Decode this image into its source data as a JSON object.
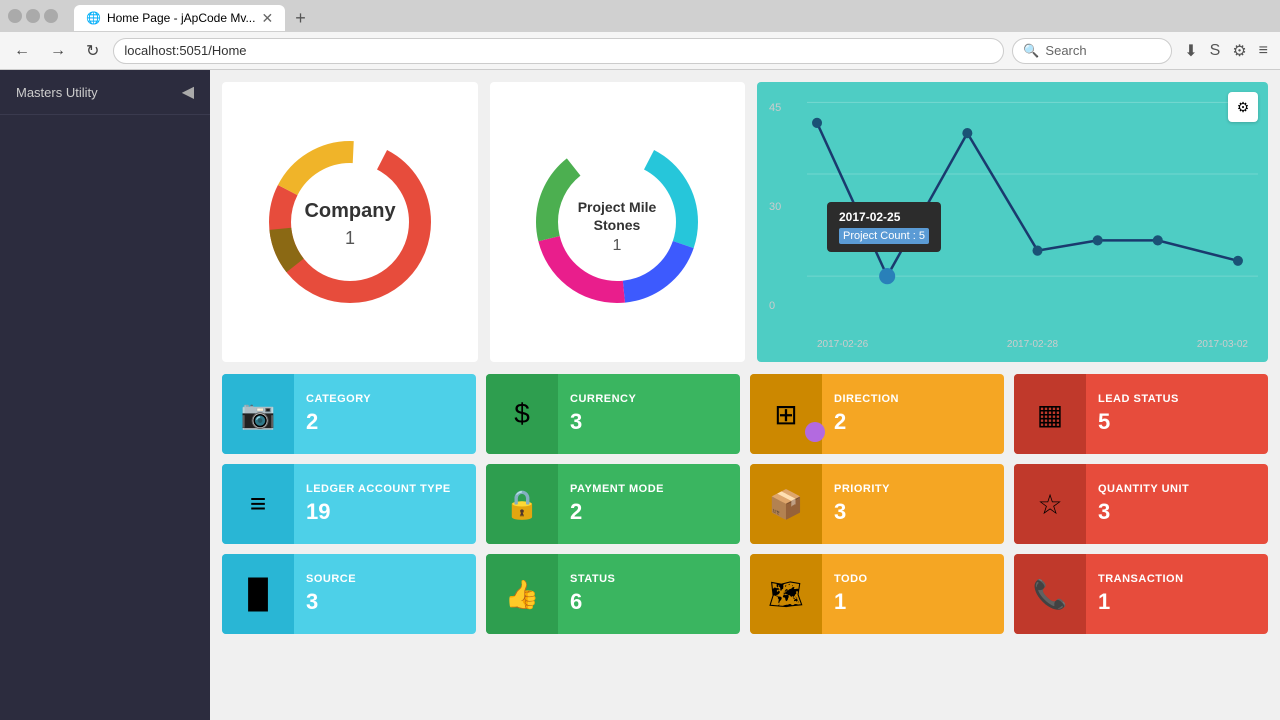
{
  "browser": {
    "title": "Home Page - jApCode Mv...",
    "url": "localhost:5051/Home",
    "search_placeholder": "Search",
    "new_tab_symbol": "+"
  },
  "sidebar": {
    "title": "Masters Utility",
    "toggle": "◀"
  },
  "charts": {
    "company": {
      "label": "Company",
      "value": "1"
    },
    "milestones": {
      "label": "Project Mile Stones",
      "value": "1"
    },
    "line": {
      "tooltip_date": "2017-02-25",
      "tooltip_label": "Project Count : 5",
      "y_labels": [
        "45",
        "30",
        "0"
      ],
      "x_labels": [
        "2017-02-26",
        "2017-02-28",
        "2017-03-02"
      ],
      "settings_icon": "⚙"
    }
  },
  "stats": [
    {
      "id": "category",
      "label": "CATEGORY",
      "value": "2",
      "icon": "📷",
      "theme": "blue-light"
    },
    {
      "id": "currency",
      "label": "CURRENCY",
      "value": "3",
      "icon": "$",
      "theme": "green"
    },
    {
      "id": "direction",
      "label": "DIRECTION",
      "value": "2",
      "icon": "⊞",
      "theme": "orange"
    },
    {
      "id": "lead-status",
      "label": "LEAD STATUS",
      "value": "5",
      "icon": "📊",
      "theme": "red"
    },
    {
      "id": "ledger-account-type",
      "label": "LEDGER ACCOUNT TYPE",
      "value": "19",
      "icon": "📋",
      "theme": "blue-light"
    },
    {
      "id": "payment-mode",
      "label": "PAYMENT MODE",
      "value": "2",
      "icon": "🔒",
      "theme": "green"
    },
    {
      "id": "priority",
      "label": "PRIORITY",
      "value": "3",
      "icon": "📦",
      "theme": "orange"
    },
    {
      "id": "quantity-unit",
      "label": "QUANTITY UNIT",
      "value": "3",
      "icon": "☆",
      "theme": "red"
    },
    {
      "id": "source",
      "label": "SOURCE",
      "value": "3",
      "icon": "📊",
      "theme": "blue-light"
    },
    {
      "id": "status",
      "label": "STATUS",
      "value": "6",
      "icon": "👍",
      "theme": "green"
    },
    {
      "id": "todo",
      "label": "TODO",
      "value": "1",
      "icon": "🗺",
      "theme": "orange"
    },
    {
      "id": "transaction",
      "label": "TRANSACTION",
      "value": "1",
      "icon": "📞",
      "theme": "red"
    }
  ]
}
